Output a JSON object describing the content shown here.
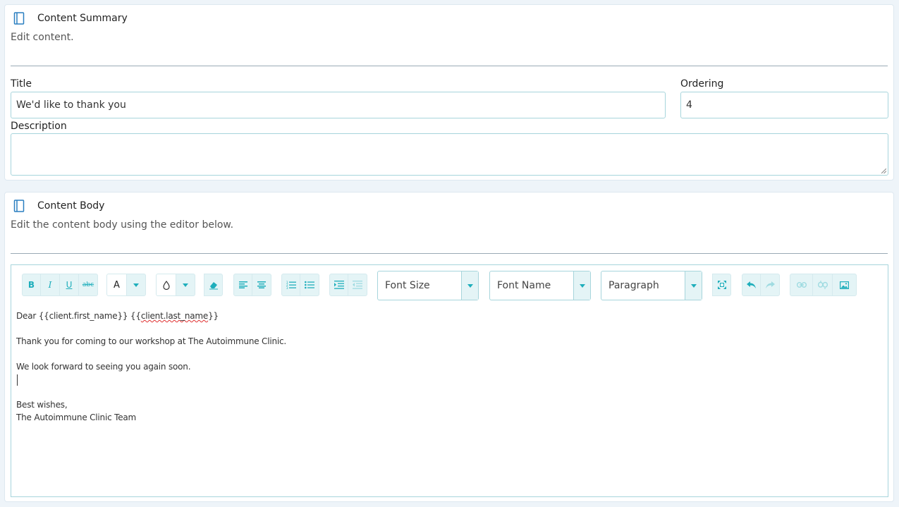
{
  "summary": {
    "title": "Content Summary",
    "subtitle": "Edit content.",
    "title_label": "Title",
    "title_value": "We'd like to thank you",
    "ordering_label": "Ordering",
    "ordering_value": "4",
    "description_label": "Description",
    "description_value": ""
  },
  "body": {
    "title": "Content Body",
    "subtitle": "Edit the content body using the editor below."
  },
  "toolbar": {
    "bold": "B",
    "italic": "I",
    "underline": "U",
    "strike": "abc",
    "font_color": "A",
    "font_size": "Font Size",
    "font_name": "Font Name",
    "paragraph": "Paragraph"
  },
  "editor": {
    "greeting_prefix": "Dear {{client.first_name}} {{",
    "greeting_mis": "client.last_name",
    "greeting_suffix": "}}",
    "line2": "Thank you for coming to our workshop at The Autoimmune Clinic.",
    "line3": "We look forward to seeing you again soon.",
    "line4": "Best wishes,",
    "line5": "The Autoimmune Clinic Team"
  },
  "colors": {
    "accent": "#1eaebb",
    "input_border": "#a7d5dc",
    "button_bg": "#e4f4f6",
    "icon_blue": "#2a7fc0"
  }
}
